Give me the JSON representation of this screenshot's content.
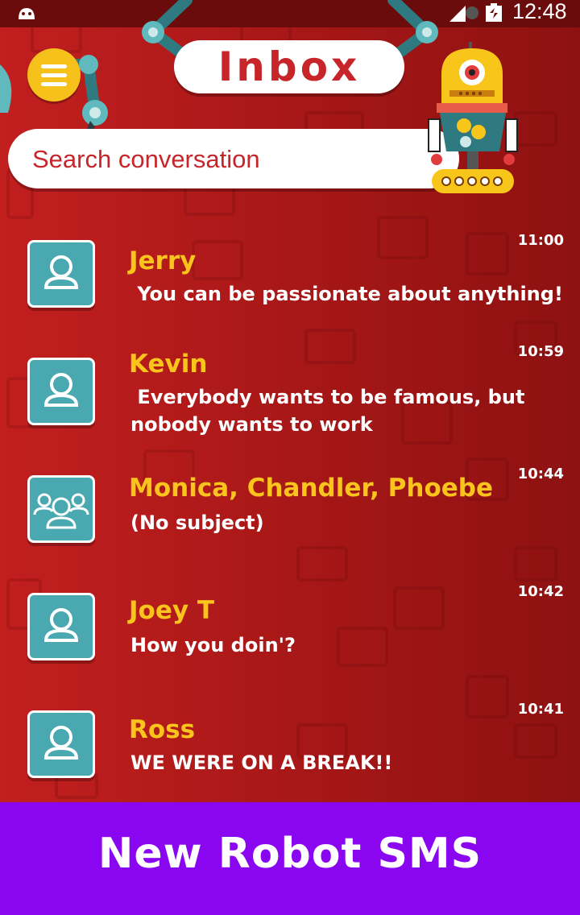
{
  "status_bar": {
    "time": "12:48",
    "app_icon": "android-icon",
    "signal_icon": "signal-icon",
    "battery_icon": "battery-icon"
  },
  "header": {
    "title": "Inbox",
    "menu_icon": "hamburger-menu-icon"
  },
  "search": {
    "placeholder": "Search conversation",
    "value": ""
  },
  "colors": {
    "background": "#b21a1a",
    "accent_yellow": "#f9c41b",
    "avatar_teal": "#4aa9b0",
    "banner_purple": "#8a06f0",
    "title_red": "#c8252b"
  },
  "conversations": [
    {
      "name": "Jerry",
      "message": " You can be passionate about anything!",
      "time": "11:00",
      "avatar": "single-user-icon"
    },
    {
      "name": "Kevin",
      "message": " Everybody wants to be famous, but nobody wants to work",
      "time": "10:59",
      "avatar": "single-user-icon"
    },
    {
      "name": "Monica, Chandler, Phoebe",
      "message": "(No subject)",
      "time": "10:44",
      "avatar": "group-users-icon"
    },
    {
      "name": "Joey T",
      "message": "How you doin'?",
      "time": "10:42",
      "avatar": "single-user-icon"
    },
    {
      "name": "Ross",
      "message": "WE WERE ON A BREAK!!",
      "time": "10:41",
      "avatar": "single-user-icon"
    }
  ],
  "banner": {
    "text": "New Robot SMS"
  }
}
